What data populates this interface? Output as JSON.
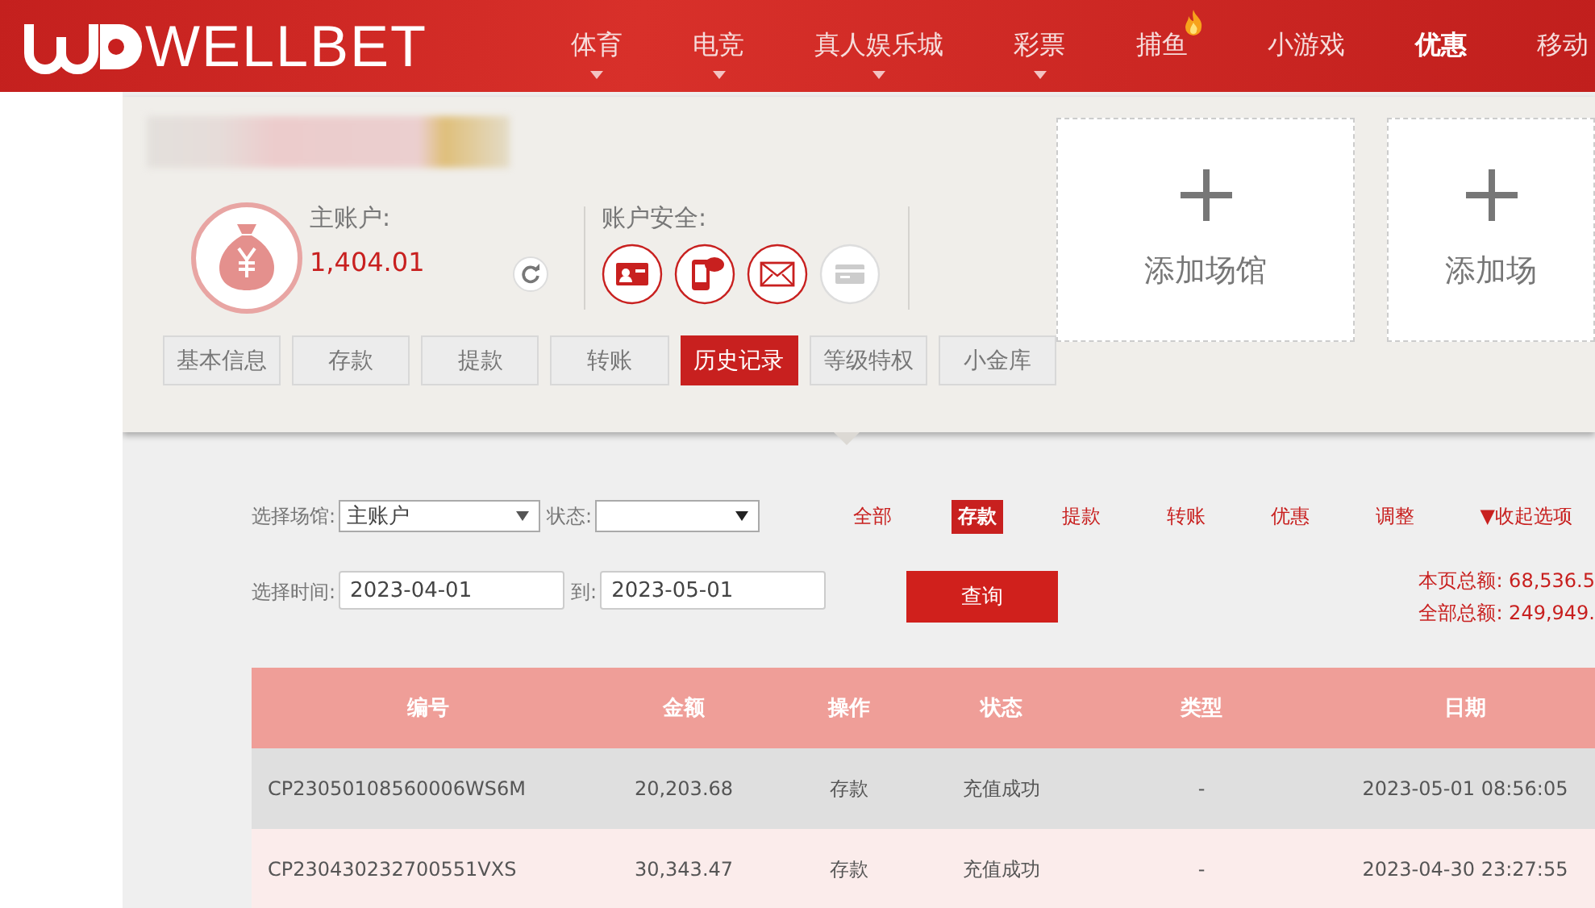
{
  "header": {
    "logo": "WELLBET",
    "nav": [
      {
        "label": "体育",
        "dropdown": true,
        "hot": false,
        "current": false
      },
      {
        "label": "电竞",
        "dropdown": true,
        "hot": false,
        "current": false
      },
      {
        "label": "真人娱乐城",
        "dropdown": true,
        "hot": false,
        "current": false
      },
      {
        "label": "彩票",
        "dropdown": true,
        "hot": false,
        "current": false
      },
      {
        "label": "捕鱼",
        "dropdown": false,
        "hot": true,
        "current": false
      },
      {
        "label": "小游戏",
        "dropdown": false,
        "hot": false,
        "current": false
      },
      {
        "label": "优惠",
        "dropdown": false,
        "hot": false,
        "current": true
      },
      {
        "label": "移动",
        "dropdown": false,
        "hot": false,
        "current": false
      }
    ]
  },
  "account": {
    "label": "主账户:",
    "balance": "1,404.01",
    "security_label": "账户安全:",
    "security": [
      {
        "kind": "id-card",
        "verified": true
      },
      {
        "kind": "sms",
        "verified": true
      },
      {
        "kind": "email",
        "verified": true
      },
      {
        "kind": "bank-card",
        "verified": false
      }
    ]
  },
  "venues": [
    {
      "label": "添加场馆"
    },
    {
      "label": "添加场"
    }
  ],
  "tabs": [
    {
      "label": "基本信息",
      "selected": false
    },
    {
      "label": "存款",
      "selected": false
    },
    {
      "label": "提款",
      "selected": false
    },
    {
      "label": "转账",
      "selected": false
    },
    {
      "label": "历史记录",
      "selected": true
    },
    {
      "label": "等级特权",
      "selected": false
    },
    {
      "label": "小金库",
      "selected": false
    }
  ],
  "filters": {
    "venue_label": "选择场馆:",
    "venue_value": "主账户",
    "status_label": "状态:",
    "time_label": "选择时间:",
    "date_from": "2023-04-01",
    "to_label": "到:",
    "date_to": "2023-05-01",
    "query_button": "查询",
    "types": [
      {
        "label": "全部",
        "selected": false
      },
      {
        "label": "存款",
        "selected": true
      },
      {
        "label": "提款",
        "selected": false
      },
      {
        "label": "转账",
        "selected": false
      },
      {
        "label": "优惠",
        "selected": false
      },
      {
        "label": "调整",
        "selected": false
      }
    ],
    "collapse": "▼收起选项",
    "page_total": "本页总额: 68,536.5",
    "all_total": "全部总额: 249,949."
  },
  "table": {
    "columns": [
      "编号",
      "金额",
      "操作",
      "状态",
      "类型",
      "日期"
    ],
    "rows": [
      [
        "CP23050108560006WS6M",
        "20,203.68",
        "存款",
        "充值成功",
        "-",
        "2023-05-01 08:56:05"
      ],
      [
        "CP230430232700551VXS",
        "30,343.47",
        "存款",
        "充值成功",
        "-",
        "2023-04-30 23:27:55"
      ]
    ]
  }
}
